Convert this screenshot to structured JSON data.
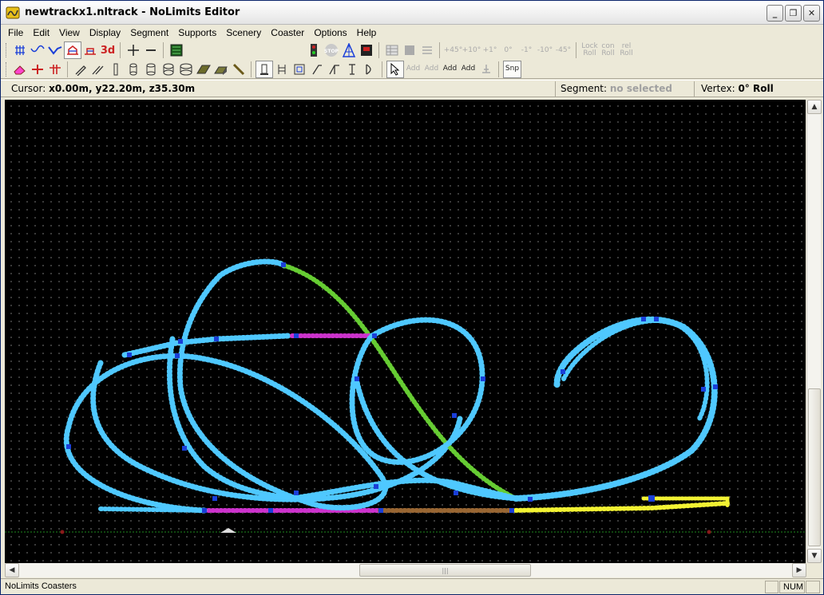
{
  "window": {
    "title": "newtrackx1.nltrack - NoLimits Editor",
    "controls": {
      "minimize": "_",
      "maximize": "❐",
      "close": "✕"
    }
  },
  "menu": [
    "File",
    "Edit",
    "View",
    "Display",
    "Segment",
    "Supports",
    "Scenery",
    "Coaster",
    "Options",
    "Help"
  ],
  "toolbar1": {
    "view_3d_label": "3d",
    "angle_buttons": [
      "+45°",
      "+10°",
      "+1°",
      "0°",
      "-1°",
      "-10°",
      "-45°"
    ],
    "roll_buttons": [
      "Lock Roll",
      "con Roll",
      "rel Roll"
    ]
  },
  "toolbar2": {
    "add_buttons": [
      "Add",
      "Add",
      "Add",
      "Add"
    ],
    "snap_label": "Snp"
  },
  "info": {
    "cursor_label": "Cursor: ",
    "cursor_value": "x0.00m, y22.20m, z35.30m",
    "segment_label": "Segment: ",
    "segment_value": "no selected",
    "vertex_label": "Vertex: ",
    "vertex_value": "0° Roll"
  },
  "colors": {
    "track_main": "#4fc8ff",
    "track_selected_green": "#66cc33",
    "track_magenta": "#cc33cc",
    "track_yellow": "#f2f233",
    "track_brown": "#996633",
    "vertex": "#1a3fd8",
    "ground": "#1e8a1e",
    "grid_dot": "#4a4a4a"
  },
  "status": {
    "text": "NoLimits Coasters",
    "num": "NUM"
  }
}
